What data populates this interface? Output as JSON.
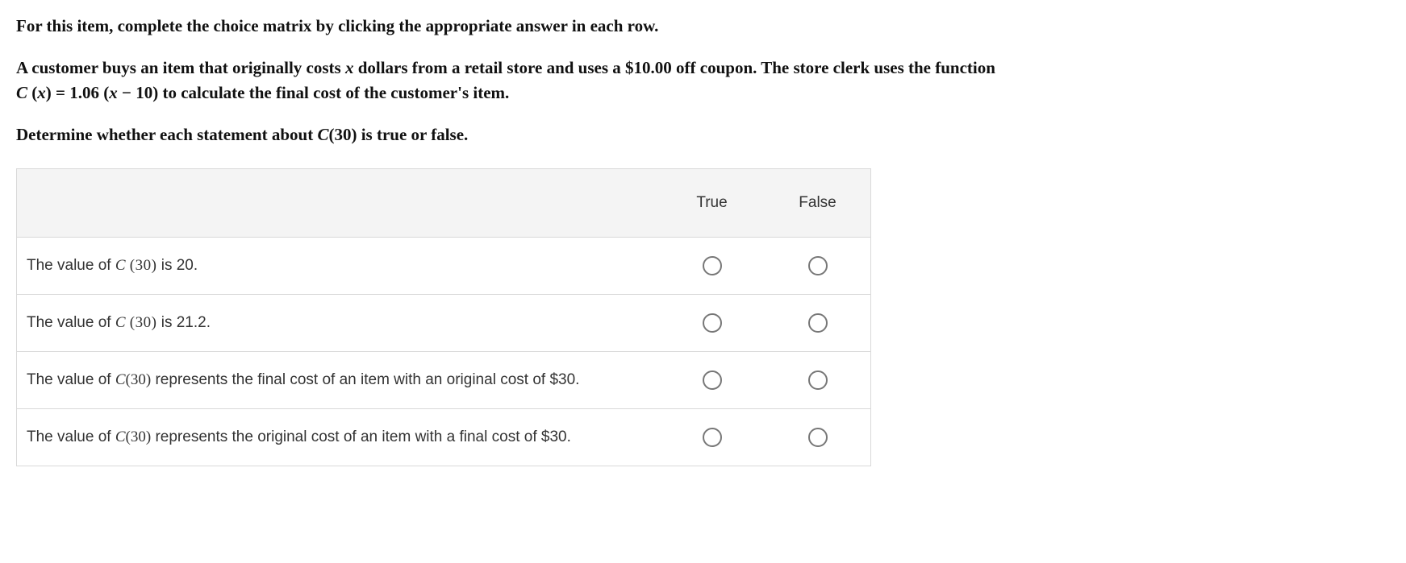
{
  "prompt": {
    "intro": "For this item, complete the choice matrix by clicking the appropriate answer in each row.",
    "scenario_a": "A customer buys an item that originally costs ",
    "scenario_b": " dollars from a retail store and uses a $10.00 off coupon. The store clerk uses the function",
    "fn_lhs_C": "C",
    "fn_lhs_paren_open": " (",
    "fn_lhs_x": "x",
    "fn_lhs_paren_close": ") ",
    "fn_eq": "= 1.06 (",
    "fn_rhs_x": "x",
    "fn_rhs_rest": " − 10)",
    "fn_tail": " to calculate the final cost of the customer's item.",
    "determine_a": "Determine whether each statement about ",
    "determine_C": "C",
    "determine_paren": "(30)",
    "determine_b": " is true or false."
  },
  "columns": {
    "true": "True",
    "false": "False"
  },
  "statements": [
    {
      "leading": "The value of ",
      "C": "C",
      "arg": " (30)",
      "trailing": " is 20."
    },
    {
      "leading": "The value of ",
      "C": "C",
      "arg": " (30)",
      "trailing": " is 21.2."
    },
    {
      "leading": "The value of ",
      "C": "C",
      "arg": "(30)",
      "trailing": " represents the final cost of an item with an original cost of $30."
    },
    {
      "leading": "The value of ",
      "C": "C",
      "arg": "(30)",
      "trailing": " represents the original cost of an item with a final cost of $30."
    }
  ]
}
